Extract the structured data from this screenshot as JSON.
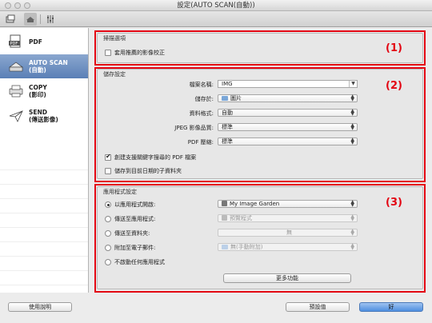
{
  "window": {
    "title": "設定(AUTO SCAN(自動))"
  },
  "toolbar": {
    "icons": [
      "scan-from-computer-icon",
      "scan-from-panel-icon",
      "general-settings-icon"
    ]
  },
  "sidebar": {
    "items": [
      {
        "label": "PDF",
        "sub": ""
      },
      {
        "label": "AUTO SCAN",
        "sub": "(自動)"
      },
      {
        "label": "COPY",
        "sub": "(影印)"
      },
      {
        "label": "SEND",
        "sub": "(傳送影像)"
      }
    ]
  },
  "scan_options": {
    "title": "掃描選項",
    "apply_correction": "套用推薦的影像校正",
    "marker": "(1)"
  },
  "save_settings": {
    "title": "儲存設定",
    "marker": "(2)",
    "file_name_label": "檔案名稱:",
    "file_name_value": "IMG",
    "save_in_label": "儲存於:",
    "save_in_value": "圖片",
    "data_format_label": "資料格式:",
    "data_format_value": "自動",
    "jpeg_quality_label": "JPEG 影像品質:",
    "jpeg_quality_value": "標準",
    "pdf_compression_label": "PDF 壓縮:",
    "pdf_compression_value": "標準",
    "keyword_pdf": "創建支援關鍵字搜尋的 PDF 檔案",
    "save_subfolder": "儲存到目前日期的子資料夾"
  },
  "app_settings": {
    "title": "應用程式設定",
    "marker": "(3)",
    "open_with_label": "以應用程式開啟:",
    "open_with_value": "My Image Garden",
    "send_to_app_label": "傳送至應用程式:",
    "send_to_app_value": "預覽程式",
    "send_to_folder_label": "傳送至資料夾:",
    "send_to_folder_value": "無",
    "attach_email_label": "附加至電子郵件:",
    "attach_email_value": "無(手動附加)",
    "no_app_label": "不啟動任何應用程式",
    "more_functions": "更多功能"
  },
  "footer": {
    "help": "使用說明",
    "defaults": "預設值",
    "ok": "好"
  },
  "colors": {
    "highlight": "#e30613",
    "selection": "#5a7fb6"
  }
}
